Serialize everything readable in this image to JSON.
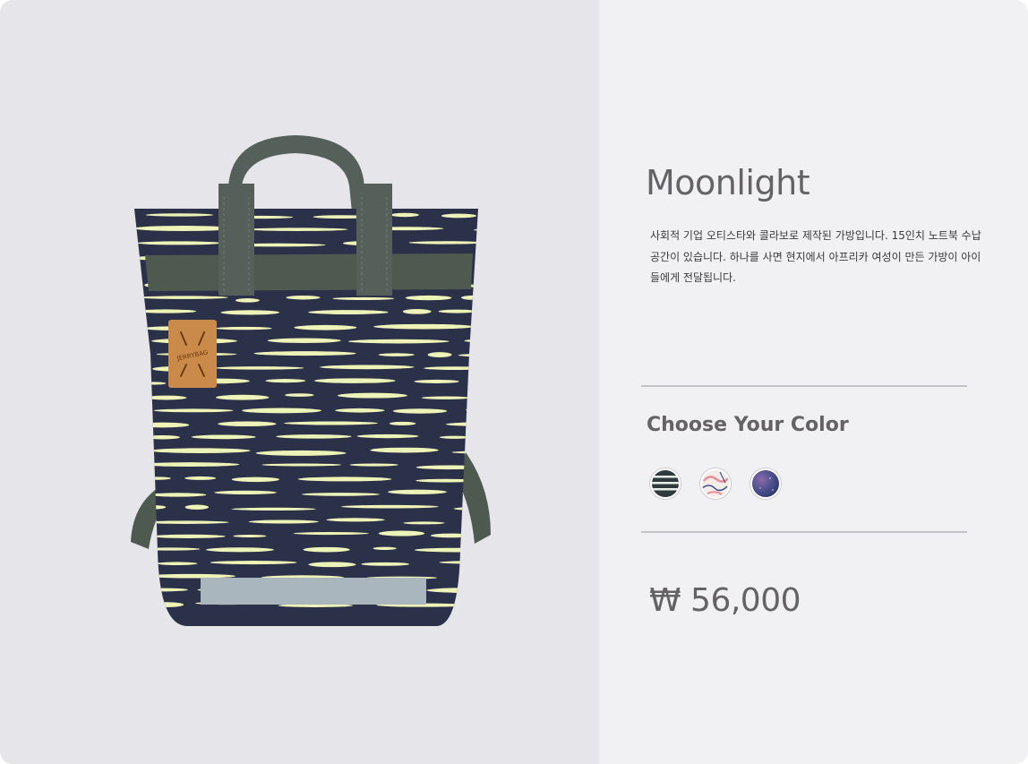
{
  "product": {
    "title": "Moonlight",
    "description": "사회적 기업 오티스타와 콜라보로 제작된 가방입니다. 15인치 노트북 수납공간이 있습니다. 하나를 사면 현지에서 아프리카 여성이 만든 가방이 아이들에게 전달됩니다.",
    "badge_text": "JERRYBAG",
    "colors": {
      "bag_navy": "#2b3148",
      "stripe_yellow": "#eef3b8",
      "strap_green": "#4e5a50",
      "leather_tan": "#c98a4a",
      "reflector": "#a9b6bd"
    }
  },
  "color_section": {
    "heading": "Choose Your Color",
    "swatches": [
      {
        "name": "navy-stripe",
        "icon": "stripe-pattern-swatch"
      },
      {
        "name": "pink-pattern",
        "icon": "pink-pattern-swatch"
      },
      {
        "name": "galaxy-purple",
        "icon": "galaxy-pattern-swatch"
      }
    ]
  },
  "price": {
    "label": "₩ 56,000"
  }
}
